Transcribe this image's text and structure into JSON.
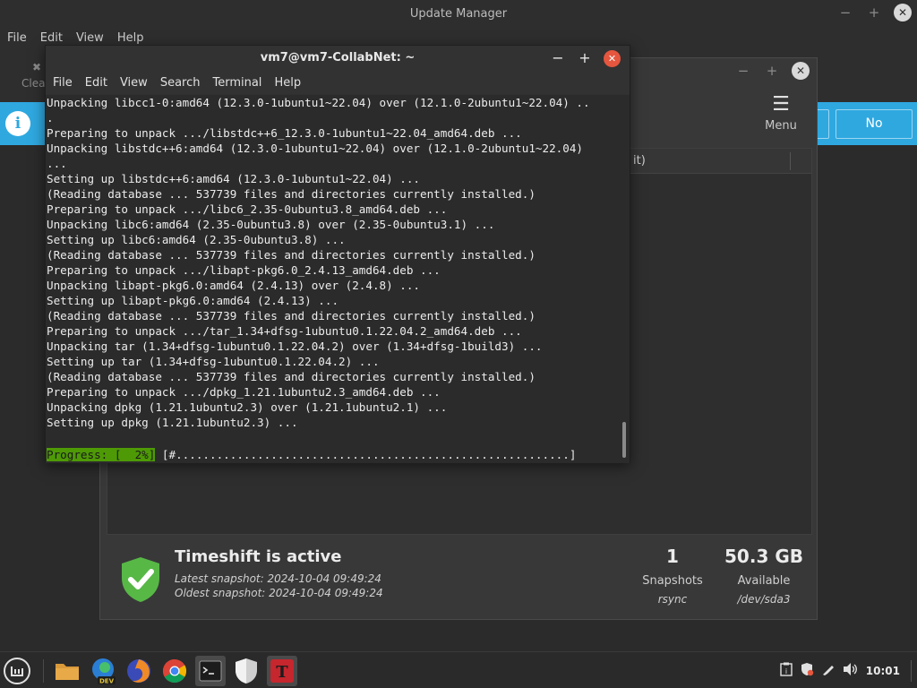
{
  "update_manager": {
    "title": "Update Manager",
    "menu": [
      "File",
      "Edit",
      "View",
      "Help"
    ],
    "toolbar_clear_label": "Clea",
    "infobar_no_label": "No",
    "controls": {
      "minimize": "−",
      "maximize": "+",
      "close": "✕"
    }
  },
  "timeshift": {
    "menu_label": "Menu",
    "menu_icon": "☰",
    "column_label": "it)",
    "status_title": "Timeshift is active",
    "latest": "Latest snapshot: 2024-10-04 09:49:24",
    "oldest": "Oldest snapshot: 2024-10-04 09:49:24",
    "snapshots_count": "1",
    "snapshots_label": "Snapshots",
    "snapshots_sub": "rsync",
    "available_size": "50.3 GB",
    "available_label": "Available",
    "available_sub": "/dev/sda3",
    "controls": {
      "minimize": "−",
      "maximize": "+",
      "close": "✕"
    }
  },
  "terminal": {
    "title": "vm7@vm7-CollabNet: ~",
    "menu": [
      "File",
      "Edit",
      "View",
      "Search",
      "Terminal",
      "Help"
    ],
    "lines": [
      "Unpacking libcc1-0:amd64 (12.3.0-1ubuntu1~22.04) over (12.1.0-2ubuntu1~22.04) ..",
      ".",
      "Preparing to unpack .../libstdc++6_12.3.0-1ubuntu1~22.04_amd64.deb ...",
      "Unpacking libstdc++6:amd64 (12.3.0-1ubuntu1~22.04) over (12.1.0-2ubuntu1~22.04)",
      "...",
      "Setting up libstdc++6:amd64 (12.3.0-1ubuntu1~22.04) ...",
      "(Reading database ... 537739 files and directories currently installed.)",
      "Preparing to unpack .../libc6_2.35-0ubuntu3.8_amd64.deb ...",
      "Unpacking libc6:amd64 (2.35-0ubuntu3.8) over (2.35-0ubuntu3.1) ...",
      "Setting up libc6:amd64 (2.35-0ubuntu3.8) ...",
      "(Reading database ... 537739 files and directories currently installed.)",
      "Preparing to unpack .../libapt-pkg6.0_2.4.13_amd64.deb ...",
      "Unpacking libapt-pkg6.0:amd64 (2.4.13) over (2.4.8) ...",
      "Setting up libapt-pkg6.0:amd64 (2.4.13) ...",
      "(Reading database ... 537739 files and directories currently installed.)",
      "Preparing to unpack .../tar_1.34+dfsg-1ubuntu0.1.22.04.2_amd64.deb ...",
      "Unpacking tar (1.34+dfsg-1ubuntu0.1.22.04.2) over (1.34+dfsg-1build3) ...",
      "Setting up tar (1.34+dfsg-1ubuntu0.1.22.04.2) ...",
      "(Reading database ... 537739 files and directories currently installed.)",
      "Preparing to unpack .../dpkg_1.21.1ubuntu2.3_amd64.deb ...",
      "Unpacking dpkg (1.21.1ubuntu2.3) over (1.21.1ubuntu2.1) ...",
      "Setting up dpkg (1.21.1ubuntu2.3) ..."
    ],
    "progress_label": "Progress: [  2%]",
    "progress_bar": " [#..........................................................]",
    "progress_percent": 2,
    "controls": {
      "minimize": "−",
      "maximize": "+",
      "close": "✕"
    }
  },
  "taskbar": {
    "apps": [
      {
        "name": "mint-menu-icon",
        "glyph": "m"
      },
      {
        "name": "files-icon",
        "glyph": ""
      },
      {
        "name": "edge-dev-icon",
        "glyph": "DEV"
      },
      {
        "name": "firefox-icon",
        "glyph": ""
      },
      {
        "name": "chrome-icon",
        "glyph": ""
      },
      {
        "name": "terminal-icon",
        "glyph": ">_"
      },
      {
        "name": "shield-icon",
        "glyph": ""
      },
      {
        "name": "typora-icon",
        "glyph": "T"
      }
    ],
    "clock": "10:01"
  },
  "colors": {
    "infobar": "#2fa8e0",
    "progress_bg": "#4e9a06",
    "terminal_close": "#e5563f",
    "shield_green": "#57b846"
  }
}
